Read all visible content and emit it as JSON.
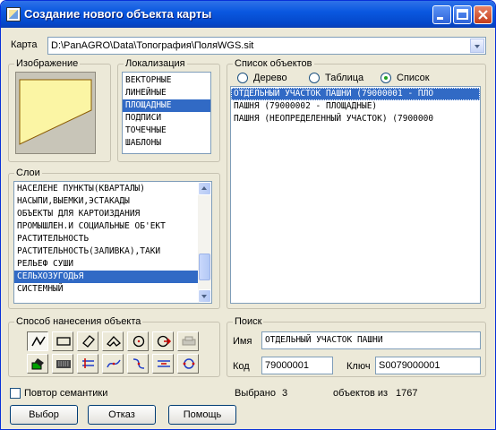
{
  "window": {
    "title": "Создание нового объекта карты",
    "min_icon": "minimize-icon",
    "max_icon": "maximize-icon",
    "close_icon": "close-icon"
  },
  "map": {
    "label": "Карта",
    "value": "D:\\PanAGRO\\Data\\Топография\\ПоляWGS.sit"
  },
  "image_group": {
    "label": "Изображение"
  },
  "localization": {
    "label": "Локализация",
    "items": [
      "ВЕКТОРНЫЕ",
      "ЛИНЕЙНЫЕ",
      "ПЛОЩАДНЫЕ",
      "ПОДПИСИ",
      "ТОЧЕЧНЫЕ",
      "ШАБЛОНЫ"
    ],
    "selected_index": 2
  },
  "layers": {
    "label": "Слои",
    "items": [
      "НАСЕЛЕНЕ ПУНКТЫ(КВАРТАЛЫ)",
      "НАСЫПИ,ВЫЕМКИ,ЭСТАКАДЫ",
      "ОБЪЕКТЫ ДЛЯ КАРТОИЗДАНИЯ",
      "ПРОМЫШЛЕН.И СОЦИАЛЬНЫЕ ОБ'ЕКТ",
      "РАСТИТЕЛЬНОСТЬ",
      "РАСТИТЕЛЬНОСТЬ(ЗАЛИВКА),ТАКИ",
      "РЕЛЬЕФ СУШИ",
      "СЕЛЬХОЗУГОДЬЯ",
      "СИСТЕМНЫЙ"
    ],
    "selected_index": 7
  },
  "objects": {
    "label": "Список объектов",
    "view_options": [
      "Дерево",
      "Таблица",
      "Список"
    ],
    "view_selected": 2,
    "items": [
      "ОТДЕЛЬНЫЙ УЧАСТОК ПАШНИ (79000001 - ПЛО",
      "ПАШНЯ (79000002 - ПЛОЩАДНЫЕ)",
      "ПАШНЯ (НЕОПРЕДЕЛЕННЫЙ УЧАСТОК) (7900000"
    ],
    "selected_index": 0
  },
  "method": {
    "label": "Способ нанесения объекта",
    "tools": [
      "polyline-tool-icon",
      "rectangle-tool-icon",
      "rotated-rectangle-tool-icon",
      "polygon-tool-icon",
      "circle-tool-icon",
      "circle-arrow-tool-icon",
      "vehicle-tool-icon",
      "bucket-fill-tool-icon",
      "keyboard-input-tool-icon",
      "parallel-lines-tool-icon",
      "curve-tool-icon",
      "spline-tool-icon",
      "double-line-tool-icon",
      "rotate-tool-icon"
    ]
  },
  "search": {
    "label": "Поиск",
    "name_label": "Имя",
    "name_value": "ОТДЕЛЬНЫЙ УЧАСТОК ПАШНИ",
    "code_label": "Код",
    "code_value": "79000001",
    "key_label": "Ключ",
    "key_value": "S0079000001"
  },
  "footer": {
    "repeat_semantics": "Повтор семантики",
    "selected_label": "Выбрано",
    "selected_count": "3",
    "of_label": "объектов из",
    "total_count": "1767"
  },
  "buttons": {
    "select": "Выбор",
    "cancel": "Отказ",
    "help": "Помощь"
  },
  "colors": {
    "titlebar": "#0a58e0",
    "selection": "#316ac5",
    "preview_fill": "#fbf5a4",
    "dialog_bg": "#ece9d8"
  }
}
